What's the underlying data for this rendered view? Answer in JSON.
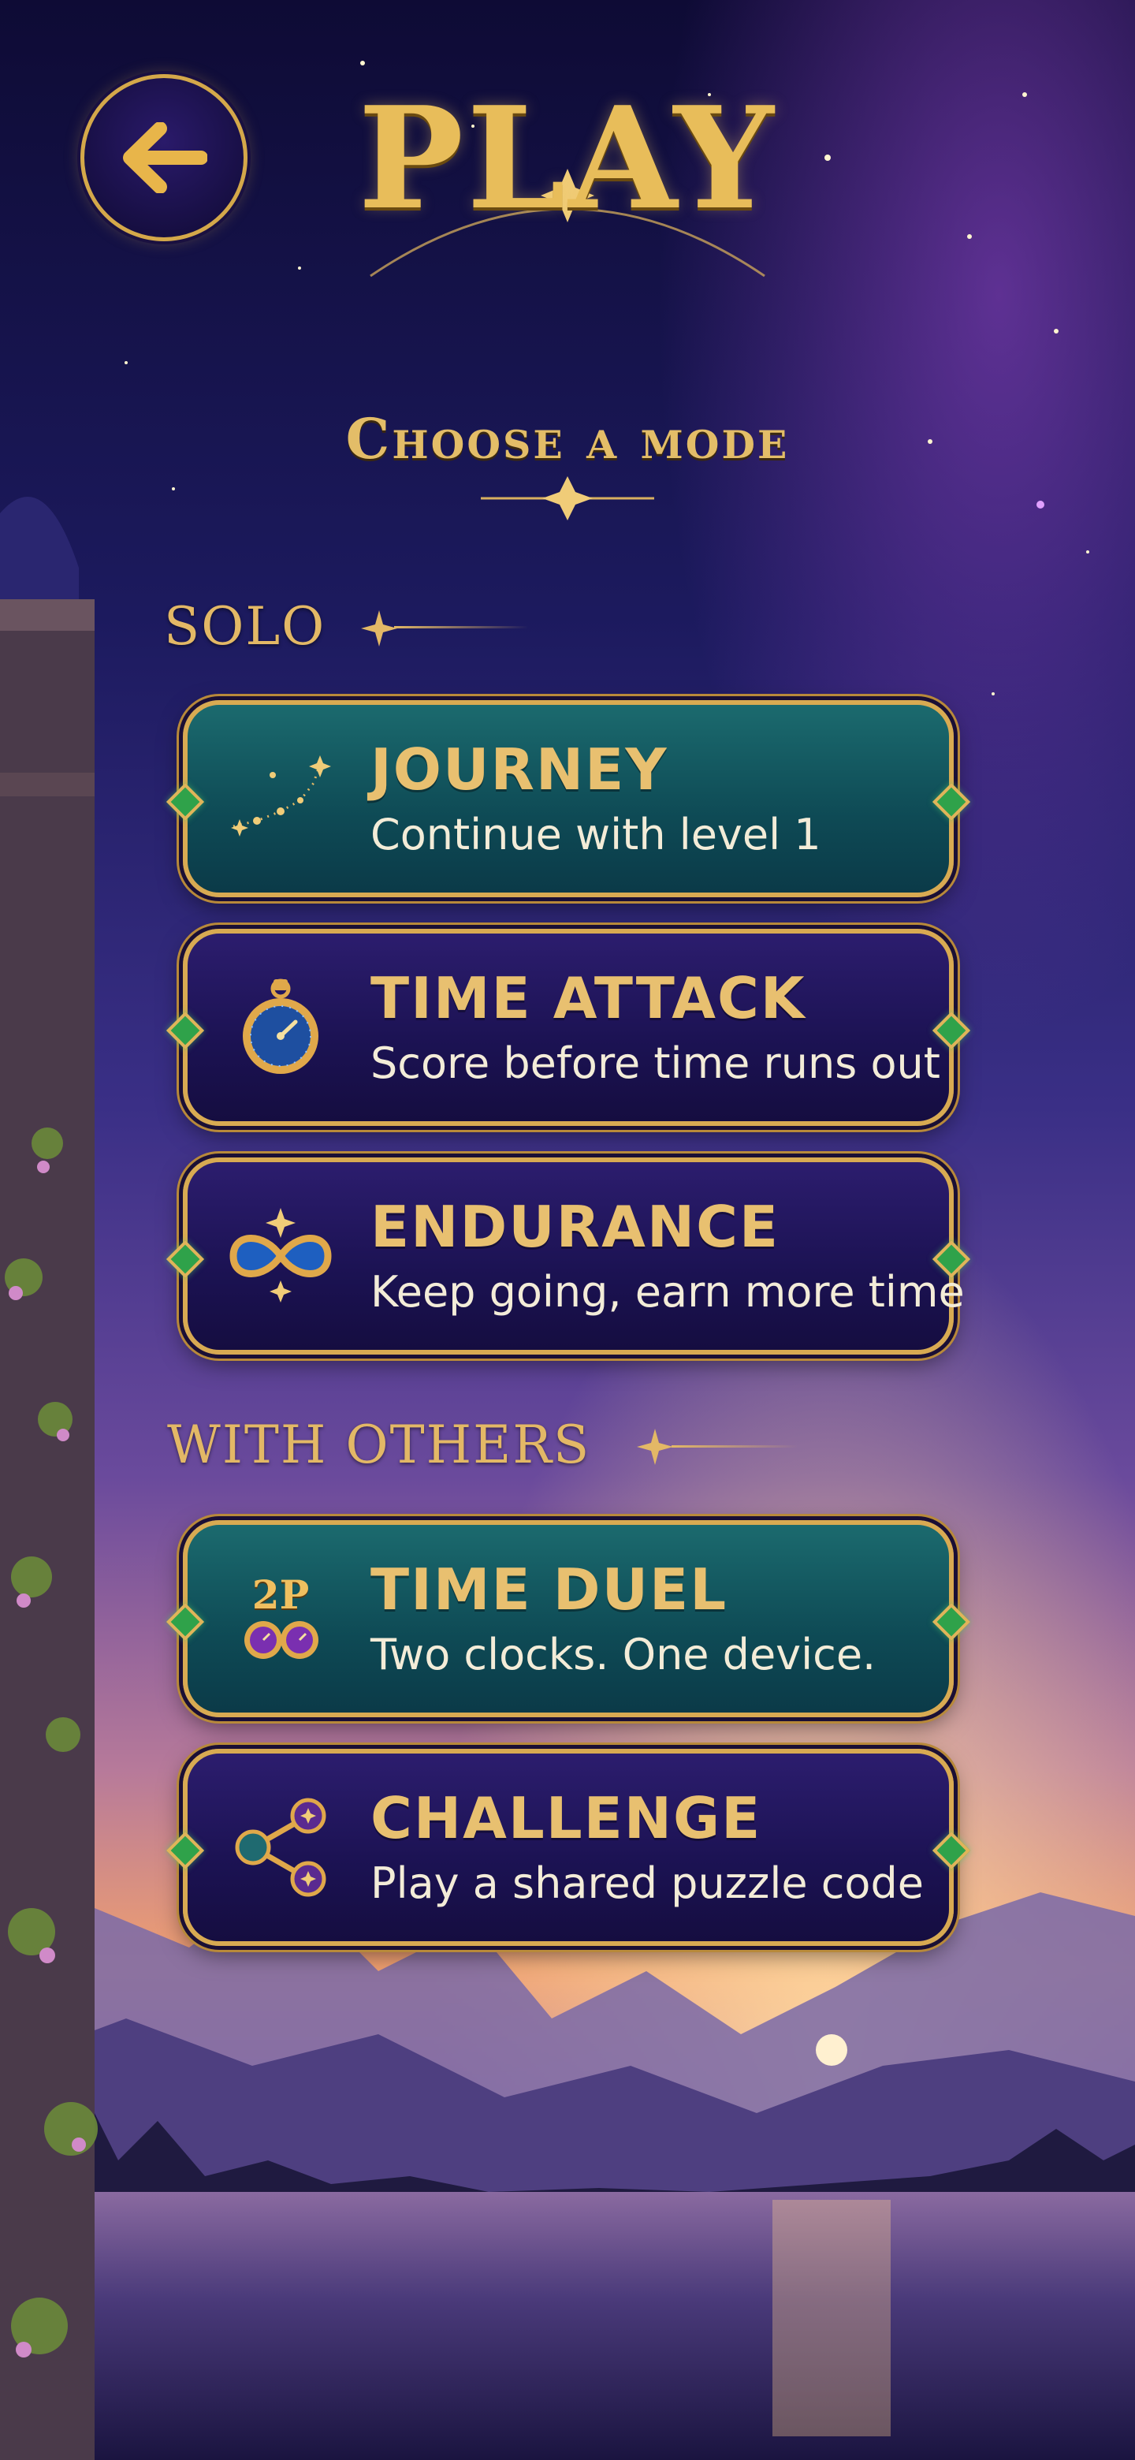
{
  "header": {
    "back_icon": "arrow-left-icon",
    "title": "PLAY",
    "subtitle": "Choose a mode"
  },
  "sections": [
    {
      "label": "SOLO"
    },
    {
      "label": "WITH OTHERS"
    }
  ],
  "modes": [
    {
      "title": "JOURNEY",
      "subtitle": "Continue with level 1",
      "icon": "constellation-icon",
      "style": "teal"
    },
    {
      "title": "TIME ATTACK",
      "subtitle": "Score before time runs out",
      "icon": "stopwatch-icon",
      "style": "purple"
    },
    {
      "title": "ENDURANCE",
      "subtitle": "Keep going, earn more time",
      "icon": "infinity-icon",
      "style": "purple"
    },
    {
      "title": "TIME DUEL",
      "subtitle": "Two clocks. One device.",
      "icon": "two-player-clocks-icon",
      "icon_text": "2P",
      "style": "teal"
    },
    {
      "title": "CHALLENGE",
      "subtitle": "Play a shared puzzle code",
      "icon": "share-icon",
      "style": "purple"
    }
  ],
  "colors": {
    "gold": "#e3b866",
    "teal_card": "#0e4a55",
    "purple_card": "#1b1252",
    "sky_top": "#141040",
    "sunset": "#e8905a"
  }
}
